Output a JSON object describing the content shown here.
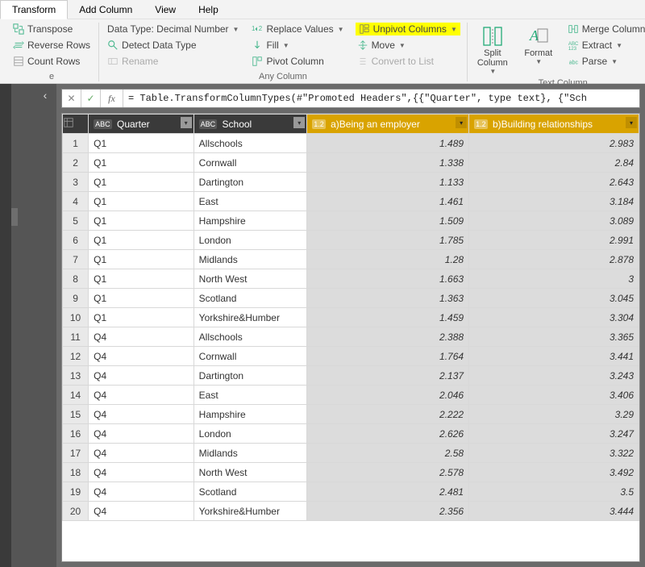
{
  "menu": {
    "items": [
      "Transform",
      "Add Column",
      "View",
      "Help"
    ],
    "active": 0
  },
  "ribbon": {
    "table_group": {
      "transpose": "Transpose",
      "reverse_rows": "Reverse Rows",
      "count_rows": "Count Rows"
    },
    "any_column_group": {
      "label": "Any Column",
      "data_type": "Data Type: Decimal Number",
      "detect_data_type": "Detect Data Type",
      "rename": "Rename",
      "replace_values": "Replace Values",
      "fill": "Fill",
      "pivot_column": "Pivot Column",
      "unpivot_columns": "Unpivot Columns",
      "move": "Move",
      "convert_to_list": "Convert to List"
    },
    "text_column_group": {
      "label": "Text Column",
      "split_column": "Split\nColumn",
      "format": "Format",
      "merge_columns": "Merge Columns",
      "extract": "Extract",
      "parse": "Parse"
    }
  },
  "formula": "= Table.TransformColumnTypes(#\"Promoted Headers\",{{\"Quarter\", type text}, {\"Sch",
  "chart_data": {
    "type": "table",
    "columns": [
      {
        "name": "Quarter",
        "type": "ABC",
        "selected": false
      },
      {
        "name": "School",
        "type": "ABC",
        "selected": false
      },
      {
        "name": "a)Being an employer",
        "type": "1.2",
        "selected": true
      },
      {
        "name": "b)Building relationships",
        "type": "1.2",
        "selected": true
      }
    ],
    "rows": [
      [
        "Q1",
        "Allschools",
        "1.489",
        "2.983"
      ],
      [
        "Q1",
        "Cornwall",
        "1.338",
        "2.84"
      ],
      [
        "Q1",
        "Dartington",
        "1.133",
        "2.643"
      ],
      [
        "Q1",
        "East",
        "1.461",
        "3.184"
      ],
      [
        "Q1",
        "Hampshire",
        "1.509",
        "3.089"
      ],
      [
        "Q1",
        "London",
        "1.785",
        "2.991"
      ],
      [
        "Q1",
        "Midlands",
        "1.28",
        "2.878"
      ],
      [
        "Q1",
        "North West",
        "1.663",
        "3"
      ],
      [
        "Q1",
        "Scotland",
        "1.363",
        "3.045"
      ],
      [
        "Q1",
        "Yorkshire&Humber",
        "1.459",
        "3.304"
      ],
      [
        "Q4",
        "Allschools",
        "2.388",
        "3.365"
      ],
      [
        "Q4",
        "Cornwall",
        "1.764",
        "3.441"
      ],
      [
        "Q4",
        "Dartington",
        "2.137",
        "3.243"
      ],
      [
        "Q4",
        "East",
        "2.046",
        "3.406"
      ],
      [
        "Q4",
        "Hampshire",
        "2.222",
        "3.29"
      ],
      [
        "Q4",
        "London",
        "2.626",
        "3.247"
      ],
      [
        "Q4",
        "Midlands",
        "2.58",
        "3.322"
      ],
      [
        "Q4",
        "North West",
        "2.578",
        "3.492"
      ],
      [
        "Q4",
        "Scotland",
        "2.481",
        "3.5"
      ],
      [
        "Q4",
        "Yorkshire&Humber",
        "2.356",
        "3.444"
      ]
    ]
  }
}
